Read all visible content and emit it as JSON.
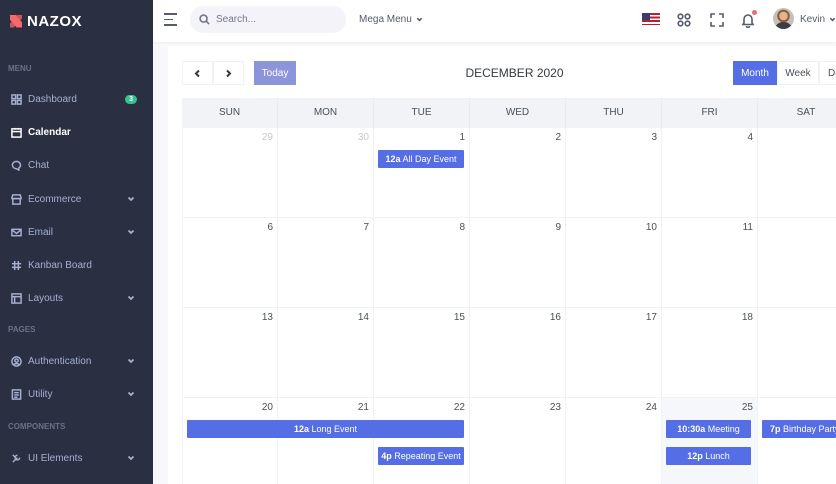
{
  "brand": {
    "name": "NAZOX"
  },
  "sidebar": {
    "section_menu": "MENU",
    "section_pages": "PAGES",
    "section_components": "COMPONENTS",
    "items": [
      {
        "label": "Dashboard",
        "badge": "3"
      },
      {
        "label": "Calendar"
      },
      {
        "label": "Chat"
      },
      {
        "label": "Ecommerce"
      },
      {
        "label": "Email"
      },
      {
        "label": "Kanban Board"
      },
      {
        "label": "Layouts"
      },
      {
        "label": "Authentication"
      },
      {
        "label": "Utility"
      },
      {
        "label": "UI Elements"
      }
    ]
  },
  "topbar": {
    "search_placeholder": "Search...",
    "mega_menu": "Mega Menu",
    "user_name": "Kevin"
  },
  "calendar": {
    "title": "DECEMBER 2020",
    "today_label": "Today",
    "views": [
      "Month",
      "Week",
      "Day"
    ],
    "weekdays": [
      "SUN",
      "MON",
      "TUE",
      "WED",
      "THU",
      "FRI",
      "SAT"
    ],
    "weeks": [
      [
        "29",
        "30",
        "1",
        "2",
        "3",
        "4",
        ""
      ],
      [
        "6",
        "7",
        "8",
        "9",
        "10",
        "11",
        ""
      ],
      [
        "13",
        "14",
        "15",
        "16",
        "17",
        "18",
        ""
      ],
      [
        "20",
        "21",
        "22",
        "23",
        "24",
        "25",
        ""
      ]
    ],
    "events": [
      {
        "time": "12a",
        "title": "All Day Event"
      },
      {
        "time": "12a",
        "title": "Long Event"
      },
      {
        "time": "4p",
        "title": "Repeating Event"
      },
      {
        "time": "10:30a",
        "title": "Meeting"
      },
      {
        "time": "12p",
        "title": "Lunch"
      },
      {
        "time": "7p",
        "title": "Birthday Party"
      }
    ]
  },
  "colors": {
    "primary": "#556ee6",
    "sidebar": "#2a3042",
    "badge": "#34c38f"
  }
}
